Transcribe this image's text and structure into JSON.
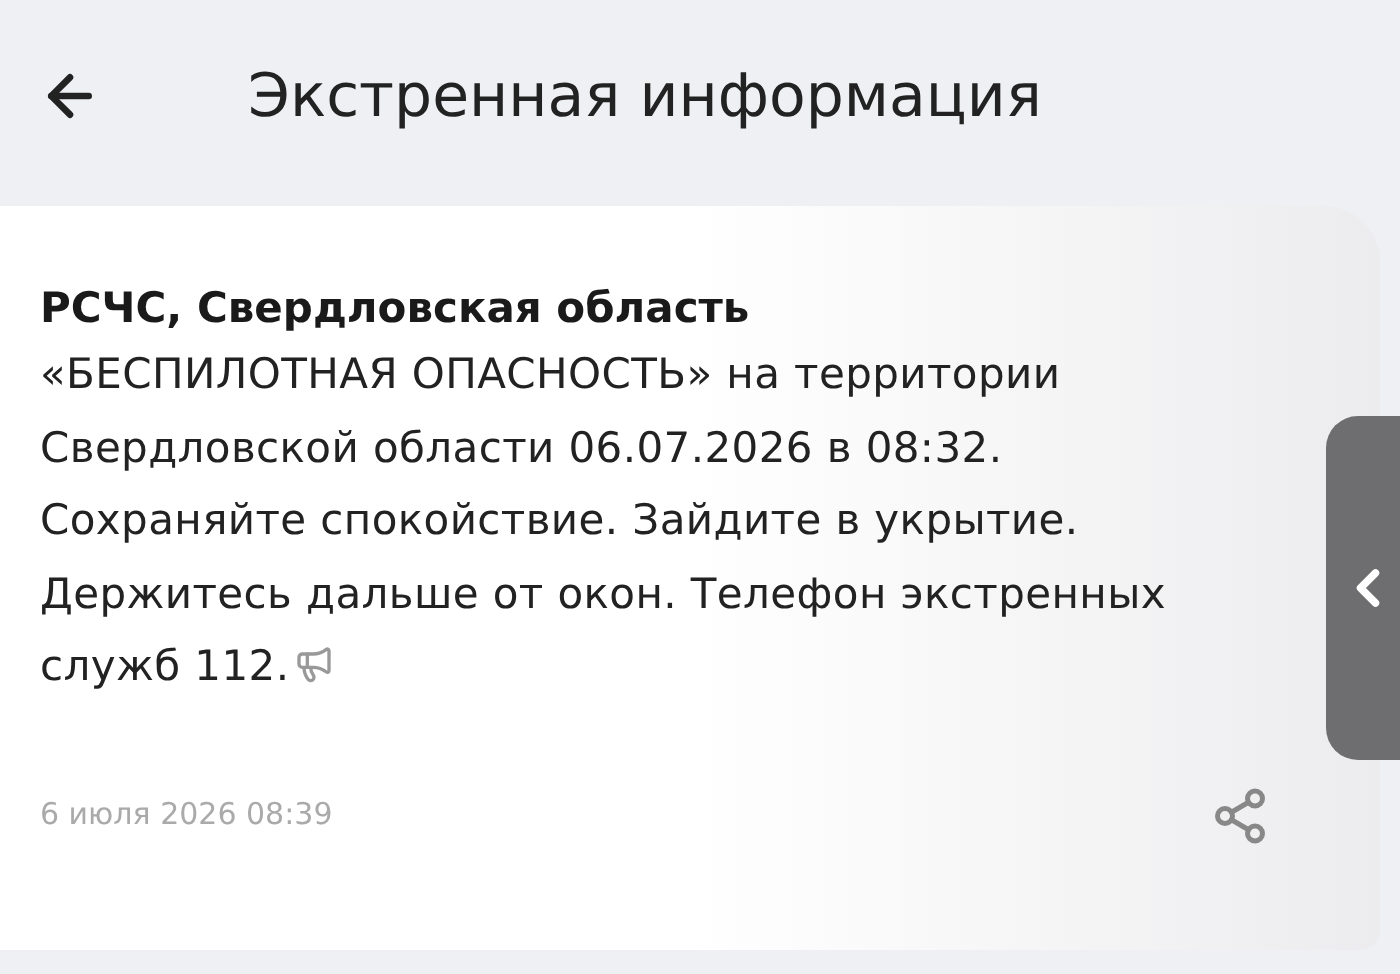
{
  "header": {
    "title": "Экстренная информация"
  },
  "message": {
    "sender": "РСЧС, Свердловская область",
    "text": "«БЕСПИЛОТНАЯ ОПАСНОСТЬ» на территории Свердловской области 06.07.2026 в 08:32. Сохраняйте спокойствие. Зайдите в укрытие. Держитесь дальше от окон. Телефон экстренных служб 112.",
    "timestamp": "6 июля 2026 08:39"
  }
}
